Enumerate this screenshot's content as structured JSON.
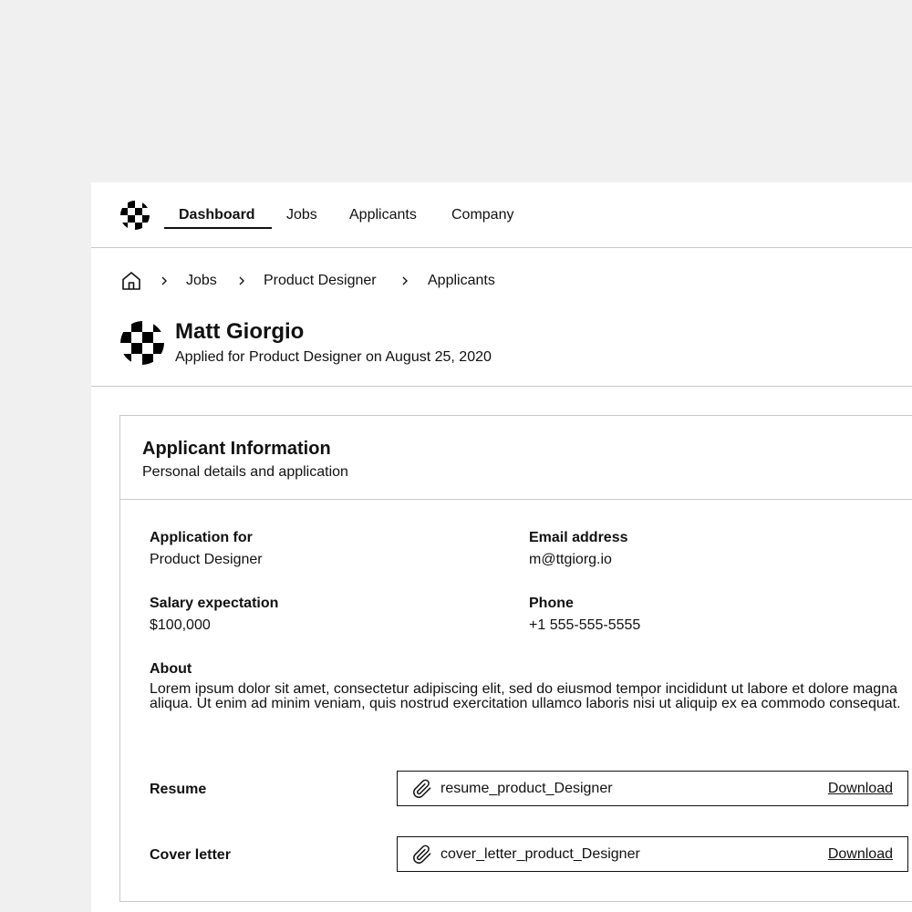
{
  "nav": {
    "items": [
      {
        "label": "Dashboard",
        "active": true
      },
      {
        "label": "Jobs"
      },
      {
        "label": "Applicants"
      },
      {
        "label": "Company"
      }
    ]
  },
  "breadcrumb": {
    "items": [
      "Jobs",
      "Product Designer",
      "Applicants"
    ]
  },
  "applicant": {
    "name": "Matt Giorgio",
    "subtitle": "Applied for Product Designer on August 25, 2020"
  },
  "card": {
    "title": "Applicant Information",
    "subtitle": "Personal details and application",
    "fields": {
      "application_for": {
        "label": "Application for",
        "value": "Product Designer"
      },
      "email": {
        "label": "Email address",
        "value": "m@ttgiorg.io"
      },
      "salary": {
        "label": "Salary expectation",
        "value": "$100,000"
      },
      "phone": {
        "label": "Phone",
        "value": "+1 555-555-5555"
      },
      "about": {
        "label": "About",
        "value": "Lorem ipsum dolor sit amet, consectetur adipiscing elit, sed do eiusmod tempor incididunt ut labore et dolore magna aliqua. Ut enim ad minim veniam, quis nostrud exercitation ullamco laboris nisi ut aliquip ex ea commodo consequat."
      }
    },
    "attachments": [
      {
        "label": "Resume",
        "file": "resume_product_Designer",
        "action": "Download"
      },
      {
        "label": "Cover letter",
        "file": "cover_letter_product_Designer",
        "action": "Download"
      }
    ]
  },
  "colors": {
    "background": "#f0f0f0",
    "panel": "#ffffff",
    "text": "#111111",
    "border": "#c8c8c8"
  },
  "icons": [
    "checker-logo-icon",
    "home-icon",
    "chevron-right-icon",
    "paperclip-icon"
  ]
}
